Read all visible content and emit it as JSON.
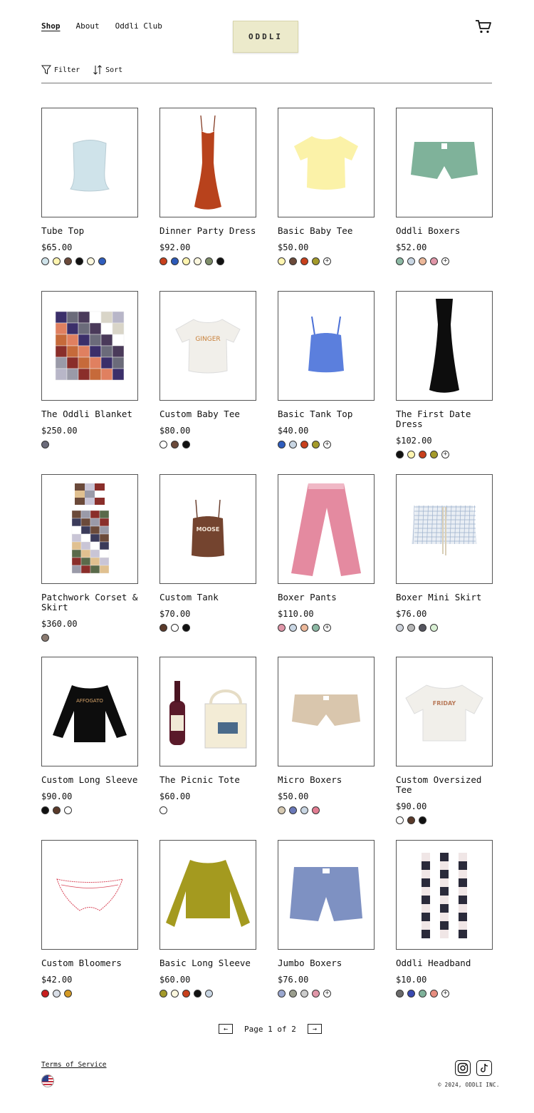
{
  "nav": {
    "shop": "Shop",
    "about": "About",
    "club": "Oddli Club"
  },
  "logo_text": "ODDLI",
  "tools": {
    "filter": "Filter",
    "sort": "Sort"
  },
  "products": [
    {
      "name": "Tube Top",
      "price": "$65.00",
      "swatches": [
        "#cfe3ea",
        "#fff5b0",
        "#6b4a3a",
        "#111111",
        "#fbf7de",
        "#2f5dbd"
      ]
    },
    {
      "name": "Dinner Party Dress",
      "price": "$92.00",
      "swatches": [
        "#c8401c",
        "#2d5ab9",
        "#fff5b0",
        "#fbf7de",
        "#7f8e6a",
        "#111111"
      ]
    },
    {
      "name": "Basic Baby Tee",
      "price": "$50.00",
      "swatches": [
        "#fff5b0",
        "#6b4a3a",
        "#c8401c",
        "#a49a2a"
      ],
      "more": "+"
    },
    {
      "name": "Oddli Boxers",
      "price": "$52.00",
      "swatches": [
        "#8cb9a4",
        "#c9d6e3",
        "#ecb89a",
        "#e096a8"
      ],
      "more": "+"
    },
    {
      "name": "The Oddli Blanket",
      "price": "$250.00",
      "swatches": [
        "#6b6b7a"
      ]
    },
    {
      "name": "Custom Baby Tee",
      "price": "$80.00",
      "swatches": [
        "#ffffff",
        "#6b4a3a",
        "#111111"
      ]
    },
    {
      "name": "Basic Tank Top",
      "price": "$40.00",
      "swatches": [
        "#2f5dbd",
        "#c9d6e3",
        "#c8401c",
        "#a49a2a"
      ],
      "more": "+"
    },
    {
      "name": "The First Date Dress",
      "price": "$102.00",
      "swatches": [
        "#111111",
        "#fff5b0",
        "#c8401c",
        "#a49a2a"
      ],
      "more": "+"
    },
    {
      "name": "Patchwork Corset & Skirt",
      "price": "$360.00",
      "swatches": [
        "#8a7a70"
      ]
    },
    {
      "name": "Custom Tank",
      "price": "$70.00",
      "swatches": [
        "#5a3a2a",
        "#ffffff",
        "#111111"
      ]
    },
    {
      "name": "Boxer Pants",
      "price": "$110.00",
      "swatches": [
        "#e096a8",
        "#c9d6e3",
        "#ecb89a",
        "#8cb9a4"
      ],
      "more": "+"
    },
    {
      "name": "Boxer Mini Skirt",
      "price": "$76.00",
      "swatches": [
        "#cfd4dc",
        "#b7b7b7",
        "#55555f",
        "#d9f0d4"
      ]
    },
    {
      "name": "Custom Long Sleeve",
      "price": "$90.00",
      "swatches": [
        "#111111",
        "#5a3a2a",
        "#ffffff"
      ]
    },
    {
      "name": "The Picnic Tote",
      "price": "$60.00",
      "swatches": [
        "#ffffff"
      ]
    },
    {
      "name": "Micro Boxers",
      "price": "$50.00",
      "swatches": [
        "#d6c9b2",
        "#6a78b8",
        "#c9d6e3",
        "#e27d92"
      ]
    },
    {
      "name": "Custom Oversized Tee",
      "price": "$90.00",
      "swatches": [
        "#ffffff",
        "#5a3a2a",
        "#111111"
      ]
    },
    {
      "name": "Custom Bloomers",
      "price": "$42.00",
      "swatches": [
        "#c81e1e",
        "#d8dde6",
        "#d49a25"
      ]
    },
    {
      "name": "Basic Long Sleeve",
      "price": "$60.00",
      "swatches": [
        "#a49a2a",
        "#fbf7de",
        "#c8401c",
        "#111111",
        "#c9d6e3"
      ]
    },
    {
      "name": "Jumbo Boxers",
      "price": "$76.00",
      "swatches": [
        "#9aa7cf",
        "#9b9e8e",
        "#cccccc",
        "#e096a8"
      ],
      "more": "+"
    },
    {
      "name": "Oddli Headband",
      "price": "$10.00",
      "swatches": [
        "#6a6a6a",
        "#3a4ab0",
        "#7fb29a",
        "#e78d7f"
      ],
      "more": "+"
    }
  ],
  "pagination": {
    "label": "Page 1 of 2",
    "prev": "←",
    "next": "→"
  },
  "footer": {
    "terms": "Terms of Service",
    "copyright": "© 2024, ODDLI INC."
  }
}
